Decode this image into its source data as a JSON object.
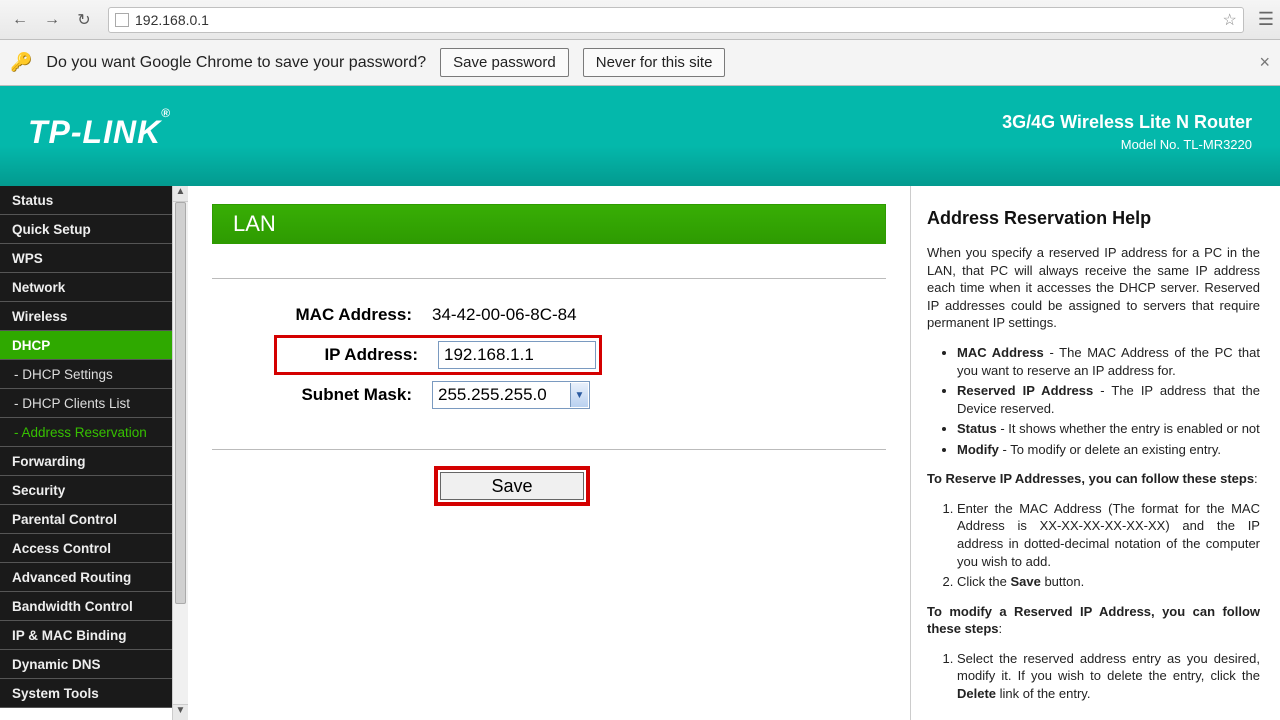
{
  "browser": {
    "url": "192.168.0.1"
  },
  "infobar": {
    "message": "Do you want Google Chrome to save your password?",
    "save_btn": "Save password",
    "never_btn": "Never for this site"
  },
  "header": {
    "brand": "TP-LINK",
    "product": "3G/4G Wireless Lite N Router",
    "model": "Model No. TL-MR3220"
  },
  "sidebar": [
    {
      "label": "Status",
      "active": false,
      "sub": false
    },
    {
      "label": "Quick Setup",
      "active": false,
      "sub": false
    },
    {
      "label": "WPS",
      "active": false,
      "sub": false
    },
    {
      "label": "Network",
      "active": false,
      "sub": false
    },
    {
      "label": "Wireless",
      "active": false,
      "sub": false
    },
    {
      "label": "DHCP",
      "active": true,
      "sub": false
    },
    {
      "label": "- DHCP Settings",
      "active": false,
      "sub": true
    },
    {
      "label": "- DHCP Clients List",
      "active": false,
      "sub": true
    },
    {
      "label": "- Address Reservation",
      "active": true,
      "sub": true
    },
    {
      "label": "Forwarding",
      "active": false,
      "sub": false
    },
    {
      "label": "Security",
      "active": false,
      "sub": false
    },
    {
      "label": "Parental Control",
      "active": false,
      "sub": false
    },
    {
      "label": "Access Control",
      "active": false,
      "sub": false
    },
    {
      "label": "Advanced Routing",
      "active": false,
      "sub": false
    },
    {
      "label": "Bandwidth Control",
      "active": false,
      "sub": false
    },
    {
      "label": "IP & MAC Binding",
      "active": false,
      "sub": false
    },
    {
      "label": "Dynamic DNS",
      "active": false,
      "sub": false
    },
    {
      "label": "System Tools",
      "active": false,
      "sub": false
    }
  ],
  "main": {
    "title": "LAN",
    "mac_label": "MAC Address:",
    "mac_value": "34-42-00-06-8C-84",
    "ip_label": "IP Address:",
    "ip_value": "192.168.1.1",
    "mask_label": "Subnet Mask:",
    "mask_value": "255.255.255.0",
    "save_btn": "Save"
  },
  "help": {
    "title": "Address Reservation Help",
    "intro": "When you specify a reserved IP address for a PC in the LAN, that PC will always receive the same IP address each time when it accesses the DHCP server. Reserved IP addresses could be assigned to servers that require permanent IP settings.",
    "b1_strong": "MAC Address",
    "b1_text": " - The MAC Address of the PC that you want to reserve an IP address for.",
    "b2_strong": "Reserved IP Address",
    "b2_text": " - The IP address that the Device reserved.",
    "b3_strong": "Status",
    "b3_text": " - It shows whether the entry is enabled or not",
    "b4_strong": "Modify",
    "b4_text": " - To modify or delete an existing entry.",
    "steps1_title": "To Reserve IP Addresses, you can follow these steps",
    "s1_1a": "Enter the MAC Address (The format for the MAC Address is ",
    "s1_1b": "XX-XX-XX-XX-XX-XX",
    "s1_1c": ") and the IP address in dotted-decimal notation of the computer you wish to add.",
    "s1_2a": "Click the ",
    "s1_2b": "Save",
    "s1_2c": " button.",
    "steps2_title": "To modify a Reserved IP Address, you can follow these steps",
    "s2_1a": "Select the reserved address entry as you desired, modify it. If you wish to delete the entry, click the ",
    "s2_1b": "Delete",
    "s2_1c": " link of the entry."
  }
}
